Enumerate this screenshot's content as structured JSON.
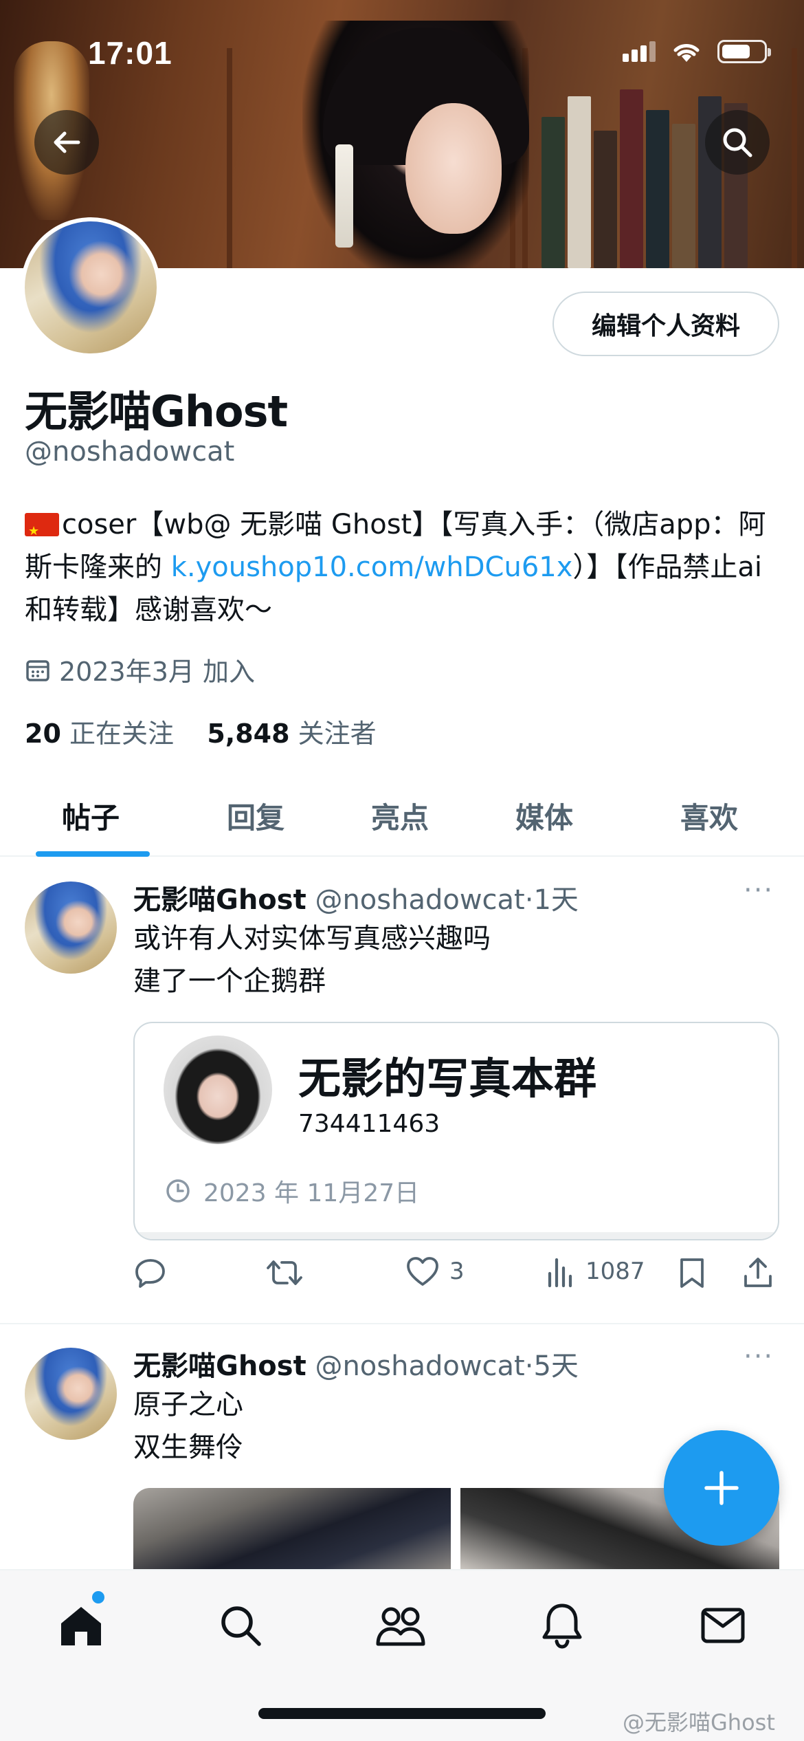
{
  "status_bar": {
    "time": "17:01"
  },
  "profile": {
    "display_name": "无影喵Ghost",
    "handle": "@noshadowcat",
    "edit_button": "编辑个人资料",
    "bio": {
      "part1": "coser【wb@ 无影喵 Ghost】【写真入手：（微店app：阿斯卡隆来的 ",
      "link": "k.youshop10.com/whDCu61x",
      "part2": "）】【作品禁止ai和转载】感谢喜欢～"
    },
    "joined": "2023年3月 加入",
    "following_count": "20",
    "following_label": "正在关注",
    "followers_count": "5,848",
    "followers_label": "关注者"
  },
  "tabs": [
    {
      "label": "帖子",
      "active": true
    },
    {
      "label": "回复"
    },
    {
      "label": "亮点"
    },
    {
      "label": "媒体"
    },
    {
      "label": "喜欢"
    }
  ],
  "posts": [
    {
      "name": "无影喵Ghost",
      "handle": "@noshadowcat",
      "time": "·1天",
      "line1": "或许有人对实体写真感兴趣吗",
      "line2": "建了一个企鹅群",
      "card": {
        "title": "无影的写真本群",
        "subtitle": "734411463",
        "date": "2023 年 11月27日"
      },
      "likes": "3",
      "views": "1087"
    },
    {
      "name": "无影喵Ghost",
      "handle": "@noshadowcat",
      "time": "·5天",
      "line1": "原子之心",
      "line2": "双生舞伶"
    }
  ],
  "more_icon": "···",
  "watermark": "@无影喵Ghost",
  "colors": {
    "accent": "#1d9bf0",
    "text": "#0f1419",
    "muted": "#536471"
  }
}
